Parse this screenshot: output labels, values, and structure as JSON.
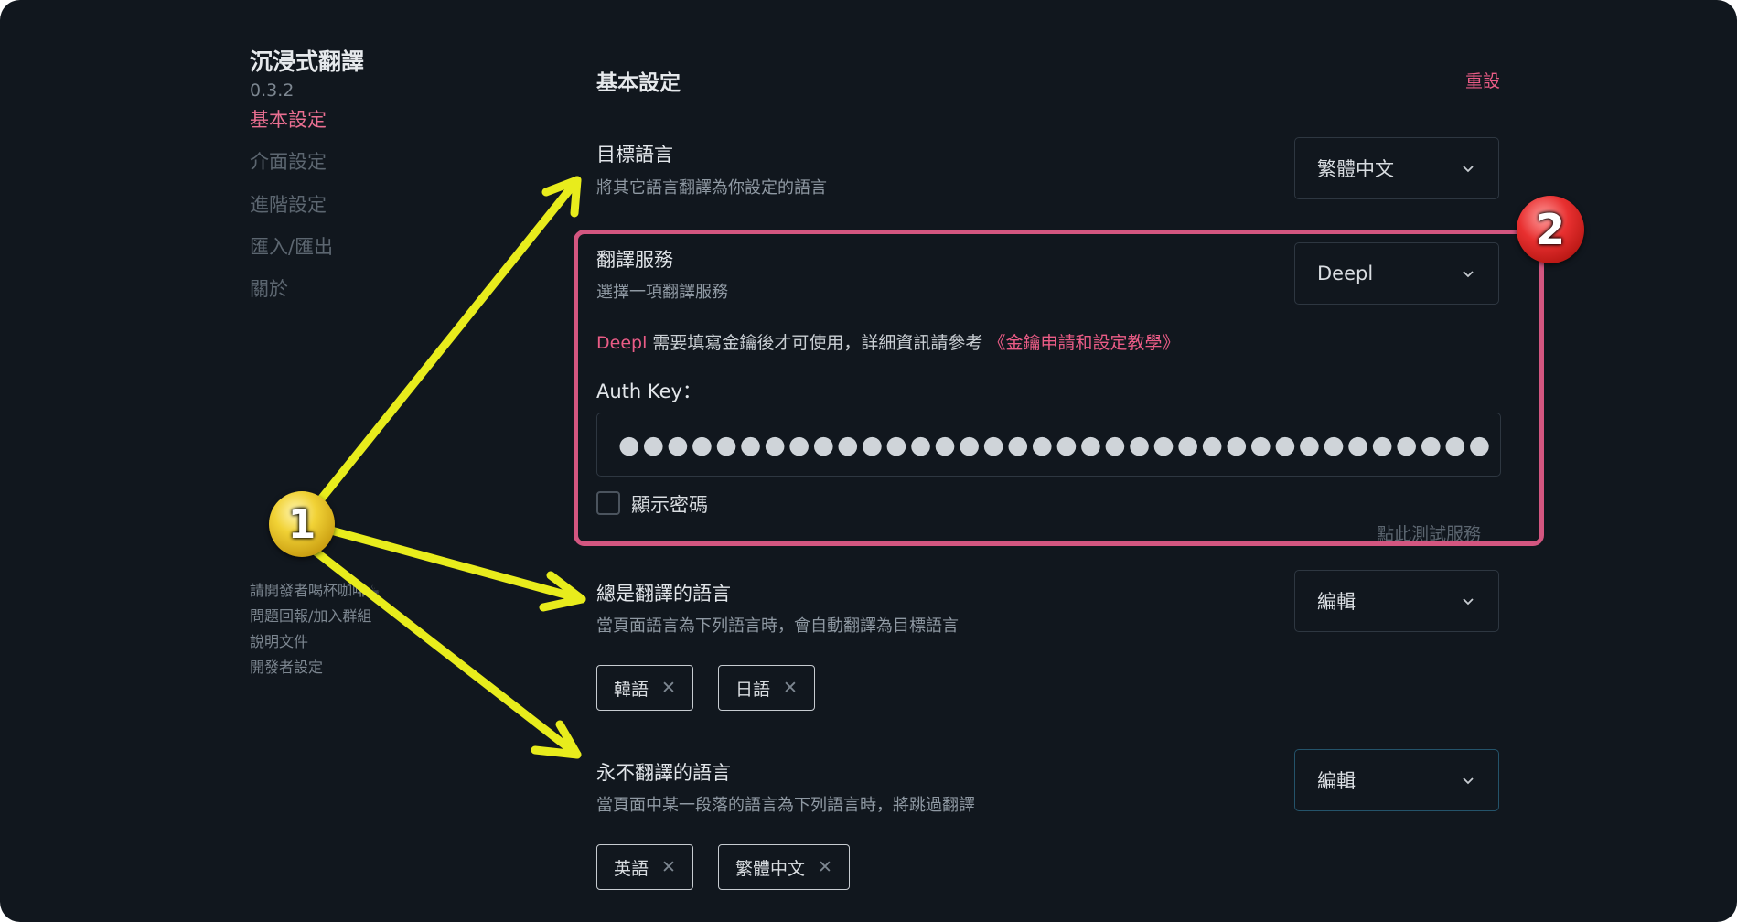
{
  "app": {
    "title": "沉浸式翻譯",
    "version": "0.3.2"
  },
  "sidebar": {
    "items": [
      {
        "label": "基本設定",
        "active": true
      },
      {
        "label": "介面設定",
        "active": false
      },
      {
        "label": "進階設定",
        "active": false
      },
      {
        "label": "匯入/匯出",
        "active": false
      },
      {
        "label": "關於",
        "active": false
      }
    ],
    "footer_links": [
      {
        "label": "請開發者喝杯咖啡☕"
      },
      {
        "label": "問題回報/加入群組"
      },
      {
        "label": "說明文件"
      },
      {
        "label": "開發者設定"
      }
    ]
  },
  "main": {
    "title": "基本設定",
    "reset_label": "重設",
    "target_language": {
      "label": "目標語言",
      "description": "將其它語言翻譯為你設定的語言",
      "selected": "繁體中文"
    },
    "translation_service": {
      "label": "翻譯服務",
      "description": "選擇一項翻譯服務",
      "selected": "Deepl",
      "notice_service": "Deepl",
      "notice_text": " 需要填寫金鑰後才可使用，詳細資訊請參考 ",
      "notice_link": "《金鑰申請和設定教學》",
      "auth_key_label": "Auth Key：",
      "auth_key_value": "●●●●●●●●●●●●●●●●●●●●●●●●●●●●●●●●●●●●",
      "show_password_label": "顯示密碼",
      "show_password_checked": false,
      "test_label": "點此測試服務"
    },
    "always_translate": {
      "label": "總是翻譯的語言",
      "description": "當頁面語言為下列語言時，會自動翻譯為目標語言",
      "select_label": "編輯",
      "tags": [
        "韓語",
        "日語"
      ]
    },
    "never_translate": {
      "label": "永不翻譯的語言",
      "description": "當頁面中某一段落的語言為下列語言時，將跳過翻譯",
      "select_label": "編輯",
      "tags": [
        "英語",
        "繁體中文"
      ]
    }
  },
  "annotations": {
    "badge_1": "1",
    "badge_2": "2"
  },
  "colors": {
    "background": "#11171e",
    "accent_pink": "#ea5c86",
    "annotation_box": "#d35680",
    "annotation_arrow": "#e8ec1c"
  }
}
